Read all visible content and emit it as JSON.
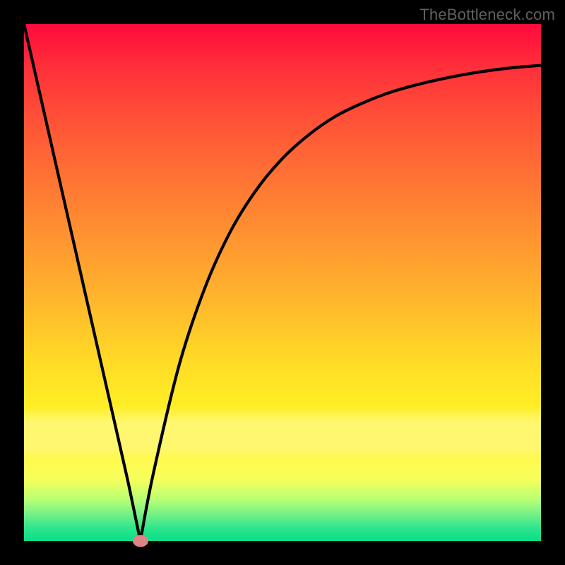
{
  "watermark": "TheBottleneck.com",
  "colors": {
    "frame": "#000000",
    "curve_stroke": "#000000",
    "dot_fill": "#e08286"
  },
  "chart_data": {
    "type": "line",
    "title": "",
    "xlabel": "",
    "ylabel": "",
    "xlim": [
      0,
      100
    ],
    "ylim": [
      0,
      100
    ],
    "grid": false,
    "legend": false,
    "series": [
      {
        "name": "bottleneck-curve",
        "x": [
          0,
          5,
          10,
          15,
          20,
          22.5,
          25,
          30,
          35,
          40,
          45,
          50,
          55,
          60,
          65,
          70,
          75,
          80,
          85,
          90,
          95,
          100
        ],
        "values": [
          100,
          78,
          56,
          34,
          12,
          0,
          13,
          34,
          49,
          60,
          68,
          74,
          78.5,
          82,
          84.5,
          86.5,
          88,
          89.2,
          90.2,
          91.0,
          91.6,
          92.0
        ]
      }
    ],
    "annotations": [
      {
        "name": "minimum-marker",
        "x": 22.5,
        "y": 0
      }
    ],
    "background_gradient_note": "traffic-light heatmap: red top to green bottom"
  }
}
